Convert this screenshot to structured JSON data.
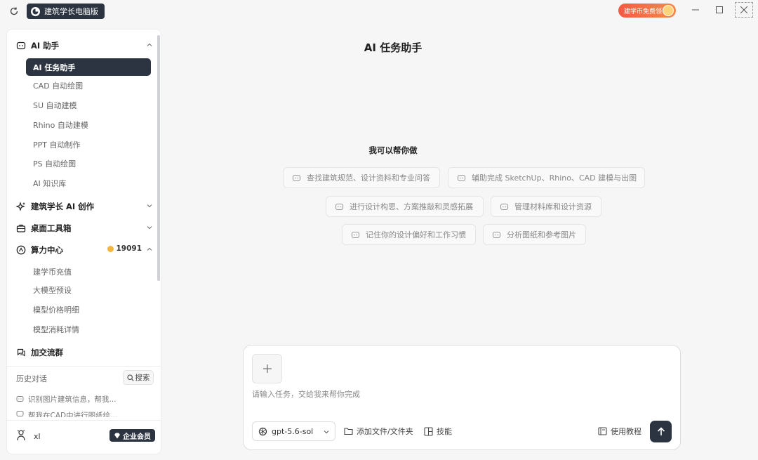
{
  "titlebar": {
    "app_name": "建筑学长电脑版",
    "promo_label": "建学币免费领"
  },
  "sidebar": {
    "sections": [
      {
        "label": "AI 助手",
        "icon": "bot-icon",
        "items": [
          {
            "label": "AI 任务助手",
            "active": true
          },
          {
            "label": "CAD 自动绘图"
          },
          {
            "label": "SU 自动建模"
          },
          {
            "label": "Rhino 自动建模"
          },
          {
            "label": "PPT 自动制作"
          },
          {
            "label": "PS 自动绘图"
          },
          {
            "label": "AI 知识库"
          }
        ]
      },
      {
        "label": "建筑学长 AI 创作",
        "icon": "sparkle-icon"
      },
      {
        "label": "桌面工具箱",
        "icon": "toolbox-icon"
      },
      {
        "label": "算力中心",
        "icon": "compass-icon",
        "coin_balance": "19091",
        "items": [
          {
            "label": "建学币充值"
          },
          {
            "label": "大模型预设"
          },
          {
            "label": "模型价格明细"
          },
          {
            "label": "模型消耗详情"
          }
        ]
      },
      {
        "label": "加交流群",
        "icon": "chat-icon"
      }
    ],
    "history": {
      "title": "历史对话",
      "search_label": "搜索",
      "items": [
        "识别图片建筑信息，帮我...",
        "帮我在CAD中进行图纸绘..."
      ]
    },
    "user": {
      "name": "xl",
      "badge_label": "企业会员"
    }
  },
  "main": {
    "title": "AI 任务助手",
    "help_title": "我可以帮你做",
    "chips": [
      "查找建筑规范、设计资料和专业问答",
      "辅助完成 SketchUp、Rhino、CAD 建模与出图",
      "进行设计构思、方案推敲和灵感拓展",
      "管理材料库和设计资源",
      "记住你的设计偏好和工作习惯",
      "分析图纸和参考图片"
    ]
  },
  "composer": {
    "placeholder": "请输入任务，交给我来帮你完成",
    "model": "gpt-5.6-sol",
    "add_files_label": "添加文件/文件夹",
    "skills_label": "技能",
    "tutorial_label": "使用教程"
  },
  "colors": {
    "accent_dark": "#2b3440",
    "promo_start": "#f25b45",
    "promo_end": "#f58a4a",
    "coin": "#f4b63e"
  }
}
